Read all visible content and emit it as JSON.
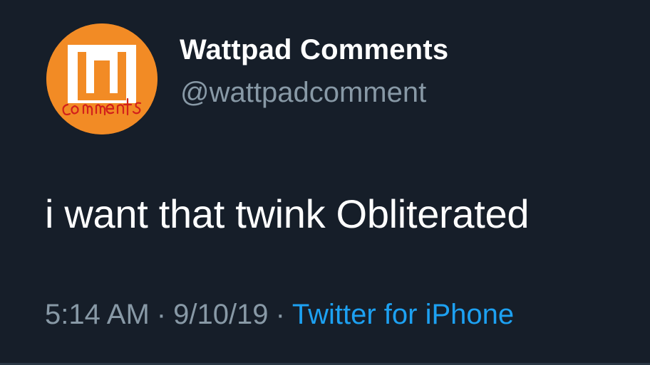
{
  "tweet": {
    "display_name": "Wattpad Comments",
    "handle": "@wattpadcomment",
    "text": "i want that twink Obliterated",
    "time": "5:14 AM",
    "date": "9/10/19",
    "separator": "·",
    "source": "Twitter for iPhone"
  },
  "avatar": {
    "icon": "wattpad-comments-logo-icon",
    "logo_letter": "w",
    "logo_word": "comments",
    "background_color": "#f28b25",
    "logo_fill_color": "#ffffff",
    "scribble_color": "#d2201b"
  },
  "colors": {
    "background": "#161e29",
    "primary_text": "#ffffff",
    "secondary_text": "#8899a6",
    "link": "#1da1f2"
  }
}
